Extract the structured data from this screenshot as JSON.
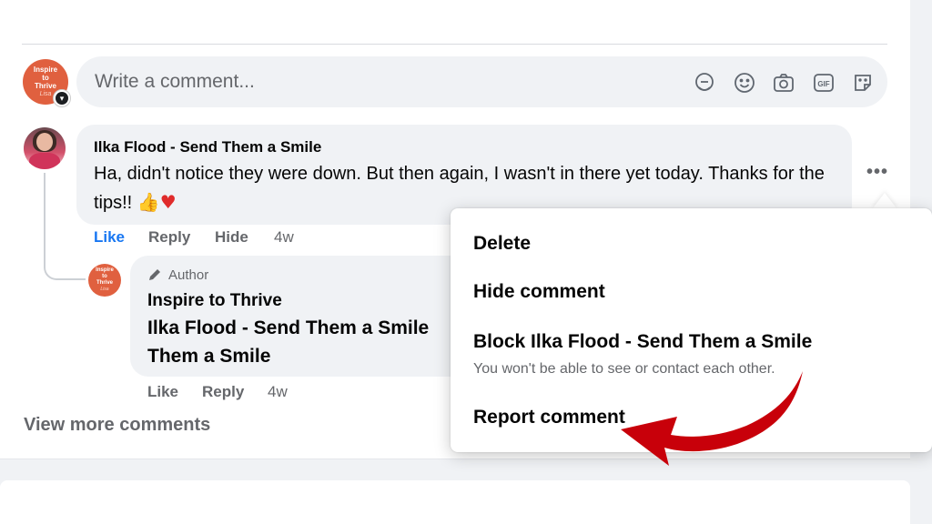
{
  "composer": {
    "placeholder": "Write a comment...",
    "avatar_lines": [
      "Inspire",
      "to",
      "Thrive"
    ],
    "avatar_signature": "Lisa",
    "icons": [
      "avatar-sticker-icon",
      "emoji-icon",
      "camera-icon",
      "gif-icon",
      "sticker-icon"
    ]
  },
  "comment": {
    "author": "Ilka Flood - Send Them a Smile",
    "text": "Ha, didn't notice they were down. But then again, I wasn't in there yet today. Thanks for the tips!!",
    "emoji_thumb": "👍",
    "emoji_heart": "♥",
    "actions": {
      "like": "Like",
      "reply": "Reply",
      "hide": "Hide",
      "time": "4w"
    },
    "more": "•••"
  },
  "reply": {
    "badge": "Author",
    "author": "Inspire to Thrive",
    "text_line1": "Ilka Flood - Send Them a Smile",
    "text_line2": "Them a Smile",
    "actions": {
      "like": "Like",
      "reply": "Reply",
      "time": "4w"
    },
    "avatar_lines": [
      "Inspire",
      "to",
      "Thrive"
    ],
    "avatar_signature": "Lisa"
  },
  "view_more": "View more comments",
  "menu": {
    "items": [
      {
        "label": "Delete"
      },
      {
        "label": "Hide comment"
      },
      {
        "label": "Block Ilka Flood - Send Them a Smile",
        "sub": "You won't be able to see or contact each other."
      },
      {
        "label": "Report comment"
      }
    ]
  },
  "colors": {
    "accent": "#1877f2",
    "brand_avatar": "#e0603f",
    "arrow": "#c8000a",
    "bubble": "#f0f2f5"
  }
}
